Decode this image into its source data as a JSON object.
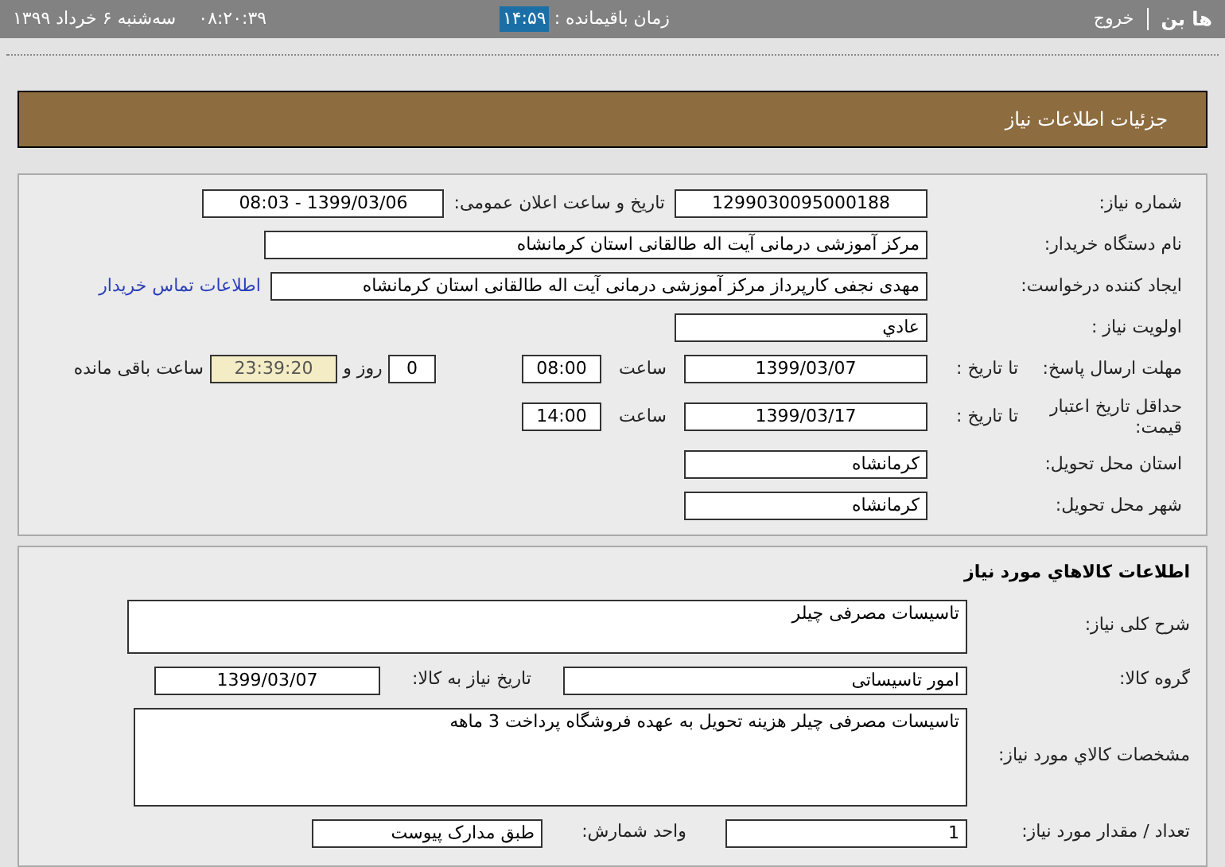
{
  "top_bar": {
    "brand": "ها بن",
    "logout": "خروج",
    "remaining_label": "زمان باقیمانده :",
    "remaining_time": "۱۴:۵۹",
    "clock": "۰۸:۲۰:۳۹",
    "date": "سه‌شنبه ۶ خرداد ۱۳۹۹"
  },
  "page_title": "جزئیات اطلاعات نیاز",
  "details": {
    "need_number": {
      "label": "شماره نیاز:",
      "value": "1299030095000188"
    },
    "announce": {
      "label": "تاریخ و ساعت اعلان عمومی:",
      "value": "1399/03/06 - 08:03"
    },
    "buyer": {
      "label": "نام دستگاه خریدار:",
      "value": "مرکز آموزشی درمانی آیت اله طالقانی استان کرمانشاه"
    },
    "creator": {
      "label": "ایجاد کننده درخواست:",
      "value": "مهدی نجفی کارپرداز مرکز آموزشی درمانی آیت اله طالقانی استان کرمانشاه",
      "link": "اطلاعات تماس خریدار"
    },
    "priority": {
      "label": "اولویت نیاز :",
      "value": "عادي"
    },
    "deadline": {
      "label": "مهلت ارسال پاسخ:",
      "to_date_label": "تا تاریخ :",
      "date": "1399/03/07",
      "time_label": "ساعت",
      "time": "08:00",
      "days": "0",
      "days_label": "روز و",
      "remaining": "23:39:20",
      "remaining_label": "ساعت باقی مانده"
    },
    "validity": {
      "label": "حداقل تاریخ اعتبار قیمت:",
      "to_date_label": "تا تاریخ :",
      "date": "1399/03/17",
      "time_label": "ساعت",
      "time": "14:00"
    },
    "province": {
      "label": "استان محل تحویل:",
      "value": "کرمانشاه"
    },
    "city": {
      "label": "شهر محل تحویل:",
      "value": "کرمانشاه"
    }
  },
  "goods": {
    "title": "اطلاعات کالاهاي مورد نياز",
    "summary": {
      "label": "شرح کلی نیاز:",
      "value": "تاسیسات مصرفی چیلر"
    },
    "group": {
      "label": "گروه کالا:",
      "value": "امور تاسیساتی",
      "date_label": "تاریخ نیاز به کالا:",
      "date": "1399/03/07"
    },
    "specs": {
      "label": "مشخصات کالاي مورد نياز:",
      "value": "تاسیسات مصرفی چیلر  هزینه تحویل به عهده فروشگاه پرداخت 3 ماهه"
    },
    "quantity": {
      "label": "تعداد / مقدار مورد نیاز:",
      "value": "1",
      "unit_label": "واحد شمارش:",
      "unit": "طبق مدارک پیوست"
    }
  }
}
